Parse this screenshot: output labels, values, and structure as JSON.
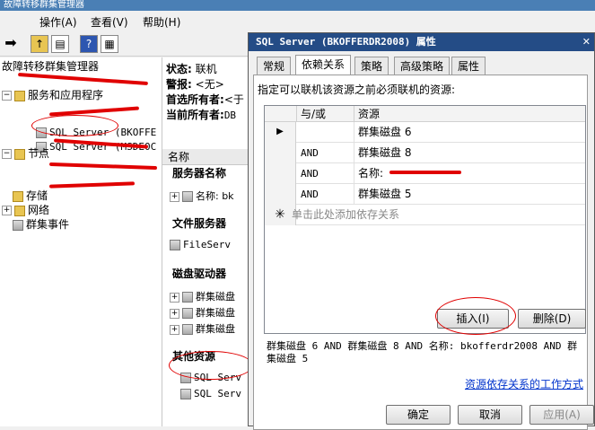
{
  "main_window": {
    "title": "故障转移群集管理器",
    "menu": [
      "操作(A)",
      "查看(V)",
      "帮助(H)"
    ]
  },
  "tree": {
    "root": "故障转移群集管理器",
    "services": "服务和应用程序",
    "sql_server_1": "SQL Server (BKOFFE",
    "sql_server_2": "SQL Server (MSDE0C",
    "nodes": "节点",
    "storage": "存储",
    "network": "网络",
    "events": "群集事件"
  },
  "detail": {
    "status_label": "状态:",
    "status_value": "联机",
    "alert_label": "警报:",
    "alert_value": "<无>",
    "preferred_owner_label": "首选所有者:",
    "preferred_owner_value": "<于",
    "current_owner_label": "当前所有者:",
    "current_owner_value": "DB",
    "column_header": "名称",
    "section_server_name": "服务器名称",
    "server_name_item": "名称: bk",
    "section_file_server": "文件服务器",
    "file_server_item": "FileServ",
    "section_disk_drives": "磁盘驱动器",
    "disks": [
      "群集磁盘",
      "群集磁盘",
      "群集磁盘"
    ],
    "section_other_resources": "其他资源",
    "other_items": [
      "SQL Serv",
      "SQL Serv"
    ]
  },
  "dialog": {
    "title": "SQL Server (BKOFFERDR2008) 属性",
    "close_label": "✕",
    "tabs": [
      "常规",
      "依赖关系",
      "策略",
      "高级策略",
      "属性"
    ],
    "instruction": "指定可以联机该资源之前必须联机的资源:",
    "grid_headers": [
      "与/或",
      "资源"
    ],
    "rows": [
      {
        "andor": "",
        "resource": "群集磁盘 6"
      },
      {
        "andor": "AND",
        "resource": "群集磁盘 8"
      },
      {
        "andor": "AND",
        "resource": "名称: "
      },
      {
        "andor": "AND",
        "resource": "群集磁盘 5"
      }
    ],
    "new_row_hint": "单击此处添加依存关系",
    "insert_button": "插入(I)",
    "delete_button": "删除(D)",
    "expression": "群集磁盘 6 AND 群集磁盘 8 AND 名称: bkofferdr2008 AND 群集磁盘 5",
    "help_link": "资源依存关系的工作方式",
    "ok_button": "确定",
    "cancel_button": "取消",
    "apply_button": "应用(A)"
  }
}
